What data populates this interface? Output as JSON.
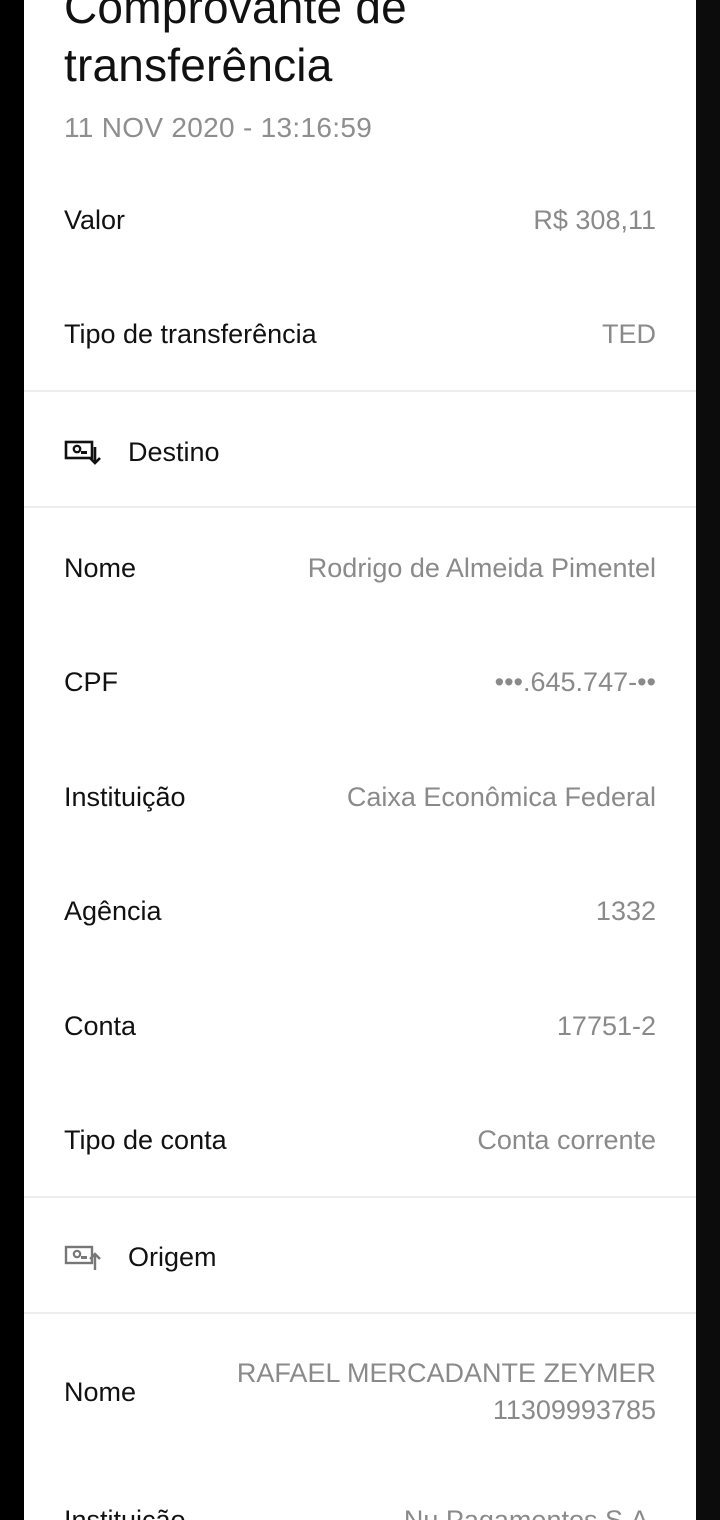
{
  "title_lines": [
    "Comprovante de",
    "transferência"
  ],
  "datetime": "11 NOV 2020 - 13:16:59",
  "summary": {
    "valor": {
      "label": "Valor",
      "value": "R$ 308,11"
    },
    "tipo": {
      "label": "Tipo de transferência",
      "value": "TED"
    }
  },
  "destino": {
    "header": "Destino",
    "icon": "money-arrow-down-icon",
    "nome": {
      "label": "Nome",
      "value": "Rodrigo de Almeida Pimentel"
    },
    "cpf": {
      "label": "CPF",
      "value": "•••.645.747-••"
    },
    "instituicao": {
      "label": "Instituição",
      "value": "Caixa Econômica Federal"
    },
    "agencia": {
      "label": "Agência",
      "value": "1332"
    },
    "conta": {
      "label": "Conta",
      "value": "17751-2"
    },
    "tipo_conta": {
      "label": "Tipo de conta",
      "value": "Conta corrente"
    }
  },
  "origem": {
    "header": "Origem",
    "icon": "money-arrow-up-icon",
    "nome": {
      "label": "Nome",
      "value_lines": [
        "RAFAEL MERCADANTE ZEYMER",
        "11309993785"
      ]
    },
    "instituicao": {
      "label": "Instituição",
      "value": "Nu Pagamentos S.A."
    }
  }
}
